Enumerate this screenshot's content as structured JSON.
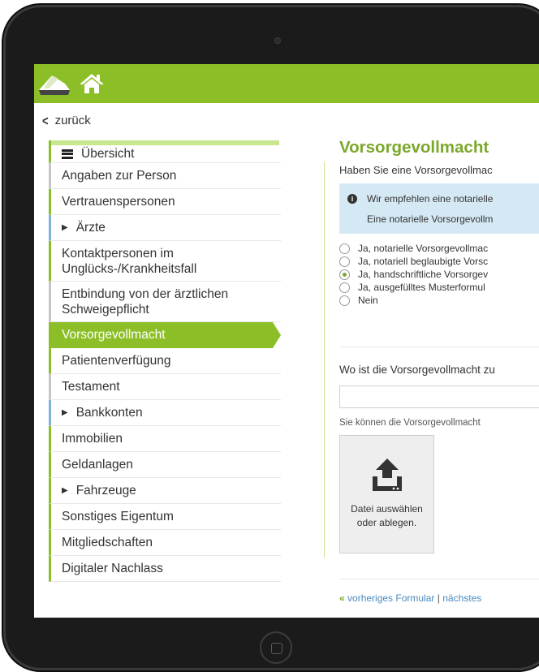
{
  "nav": {
    "back_label": "zurück"
  },
  "sidebar": {
    "items": [
      {
        "label": "Übersicht"
      },
      {
        "label": "Angaben zur Person"
      },
      {
        "label": "Vertrauenspersonen"
      },
      {
        "label": "Ärzte"
      },
      {
        "label": "Kontaktpersonen im Unglücks-/Krankheitsfall"
      },
      {
        "label": "Entbindung von der ärztlichen Schweigepflicht"
      },
      {
        "label": "Vorsorgevollmacht"
      },
      {
        "label": "Patientenverfügung"
      },
      {
        "label": "Testament"
      },
      {
        "label": "Bankkonten"
      },
      {
        "label": "Immobilien"
      },
      {
        "label": "Geldanlagen"
      },
      {
        "label": "Fahrzeuge"
      },
      {
        "label": "Sonstiges Eigentum"
      },
      {
        "label": "Mitgliedschaften"
      },
      {
        "label": "Digitaler Nachlass"
      }
    ]
  },
  "main": {
    "title": "Vorsorgevollmacht",
    "question": "Haben Sie eine Vorsorgevollmac",
    "info_line1": "Wir empfehlen eine notarielle",
    "info_line2": "Eine notarielle Vorsorgevollm",
    "options": [
      {
        "label": "Ja, notarielle Vorsorgevollmac",
        "selected": false
      },
      {
        "label": "Ja, notariell beglaubigte Vorsc",
        "selected": false
      },
      {
        "label": "Ja, handschriftliche Vorsorgev",
        "selected": true
      },
      {
        "label": "Ja, ausgefülltes Musterformul",
        "selected": false
      },
      {
        "label": "Nein",
        "selected": false
      }
    ],
    "location_label": "Wo ist die Vorsorgevollmacht zu",
    "location_value": "",
    "upload_hint": "Sie können die Vorsorgevollmacht",
    "upload_line1": "Datei auswählen",
    "upload_line2": "oder ablegen.",
    "prev_label": "vorheriges Formular",
    "separator": "|",
    "next_label": "nächstes",
    "prev_symbol": "«"
  },
  "colors": {
    "brand_green": "#8cbf27",
    "title_green": "#7aa82a",
    "info_blue": "#d5e9f5",
    "device_frame": "#1b1b1b"
  }
}
